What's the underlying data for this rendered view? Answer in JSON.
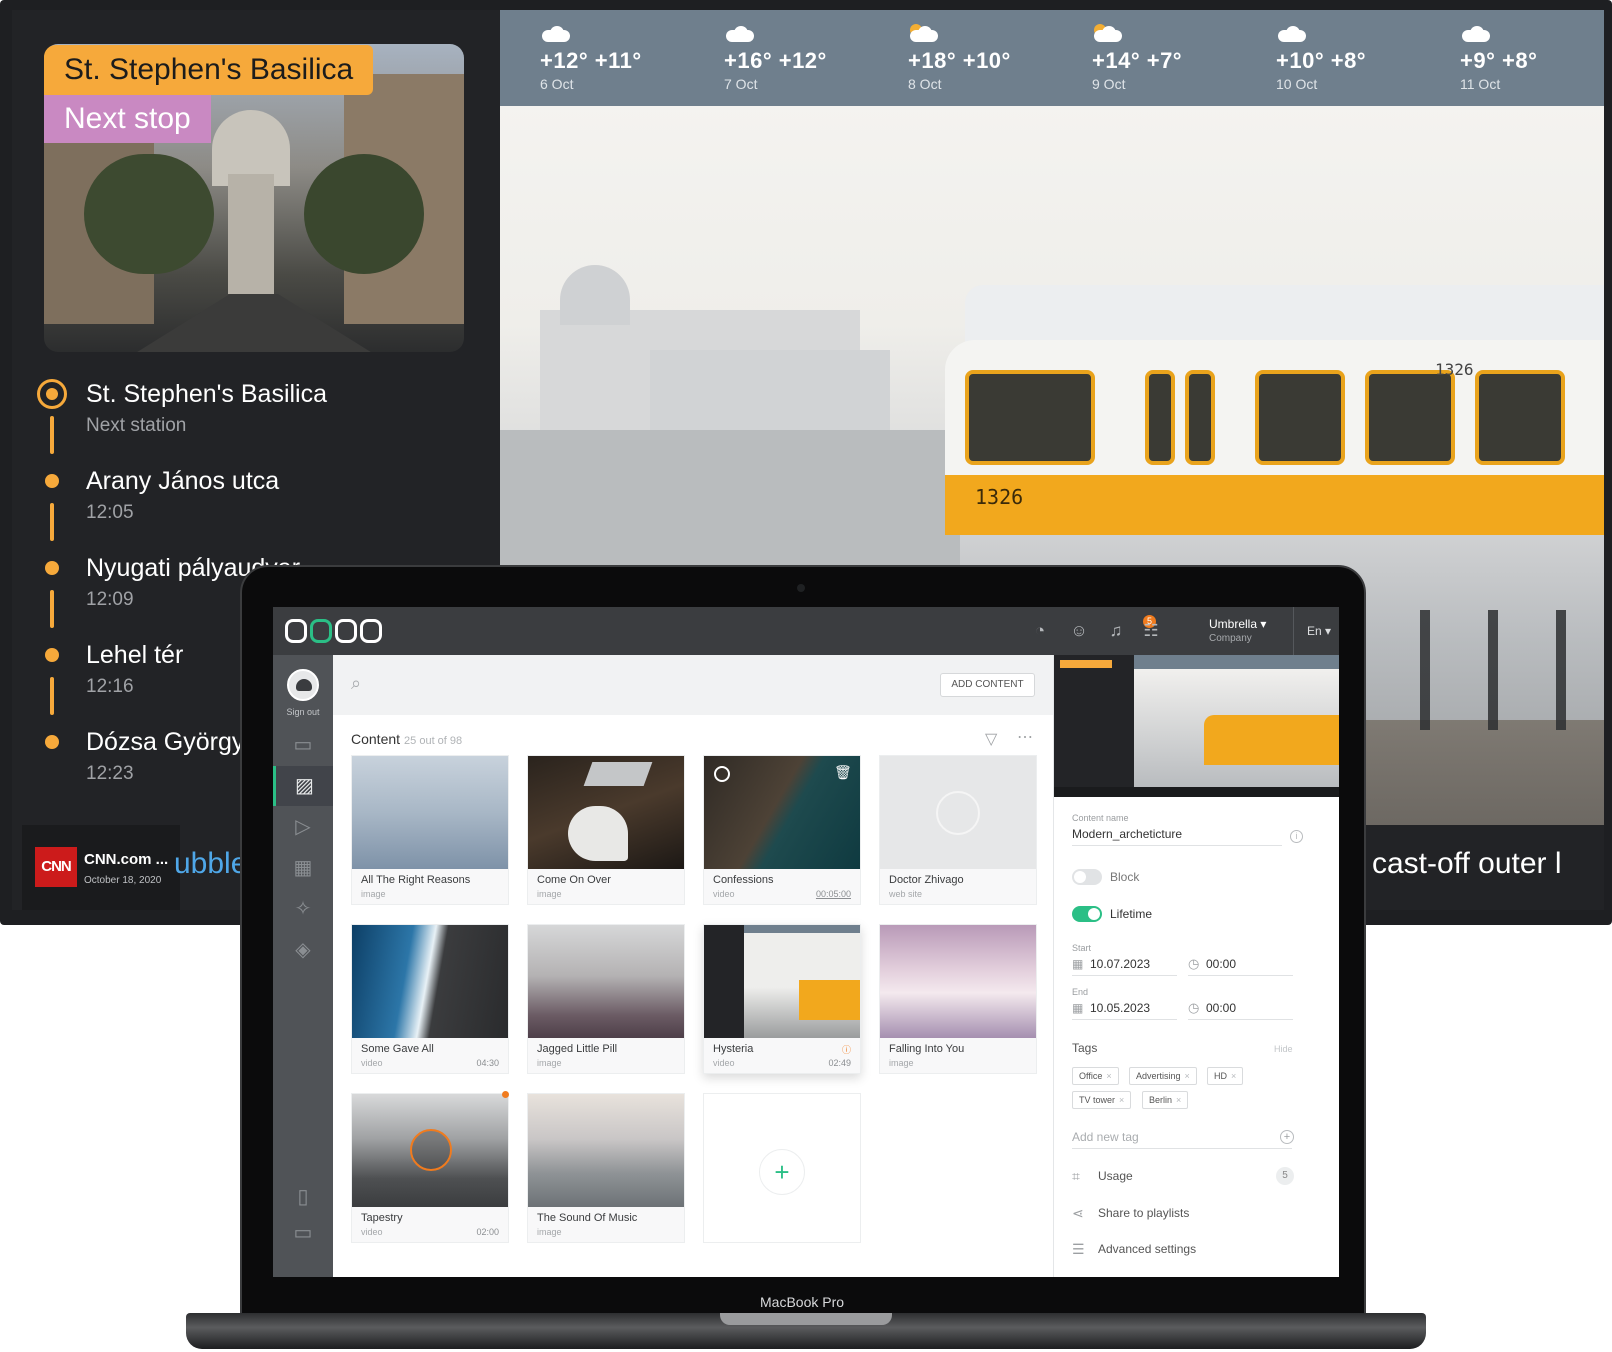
{
  "tv": {
    "stop_title": "St. Stephen's Basilica",
    "stop_subtitle": "Next stop",
    "route": [
      {
        "name": "St. Stephen's Basilica",
        "info": "Next station",
        "current": true
      },
      {
        "name": "Arany János utca",
        "info": "12:05",
        "current": false
      },
      {
        "name": "Nyugati pályaudvar",
        "info": "12:09",
        "current": false
      },
      {
        "name": "Lehel tér",
        "info": "12:16",
        "current": false
      },
      {
        "name": "Dózsa György",
        "info": "12:23",
        "current": false
      }
    ],
    "weather": [
      {
        "temp": "+12° +11°",
        "date": "6 Oct",
        "icon": "cloud-icon"
      },
      {
        "temp": "+16° +12°",
        "date": "7 Oct",
        "icon": "cloud-icon"
      },
      {
        "temp": "+18° +10°",
        "date": "8 Oct",
        "icon": "sun-cloud-icon"
      },
      {
        "temp": "+14° +7°",
        "date": "9 Oct",
        "icon": "sun-cloud-icon"
      },
      {
        "temp": "+10° +8°",
        "date": "10 Oct",
        "icon": "cloud-icon"
      },
      {
        "temp": "+9° +8°",
        "date": "11 Oct",
        "icon": "cloud-icon"
      }
    ],
    "tram_number": "1326",
    "news": {
      "logo": "CNN",
      "source": "CNN.com ...",
      "date": "October 18, 2020",
      "ticker_left": "ubble",
      "ticker_right": "cast-off outer l"
    }
  },
  "laptop": {
    "brand": "MacBook Pro",
    "topbar": {
      "notifications_count": "5",
      "account_name": "Umbrella ▾",
      "account_role": "Company",
      "language": "En ▾"
    },
    "sidenav": {
      "signout_label": "Sign out"
    },
    "main": {
      "add_content_label": "ADD CONTENT",
      "content_title": "Content",
      "content_count": "25 out of 98",
      "cards": [
        {
          "title": "All The Right Reasons",
          "type": "image",
          "duration": ""
        },
        {
          "title": "Come On Over",
          "type": "image",
          "duration": ""
        },
        {
          "title": "Confessions",
          "type": "video",
          "duration": "00:05:00"
        },
        {
          "title": "Doctor Zhivago",
          "type": "web site",
          "duration": ""
        },
        {
          "title": "Some Gave All",
          "type": "video",
          "duration": "04:30"
        },
        {
          "title": "Jagged Little Pill",
          "type": "image",
          "duration": ""
        },
        {
          "title": "Hysteria",
          "type": "video",
          "duration": "02:49"
        },
        {
          "title": "Falling Into You",
          "type": "image",
          "duration": ""
        },
        {
          "title": "Tapestry",
          "type": "video",
          "duration": "02:00"
        },
        {
          "title": "The Sound Of Music",
          "type": "image",
          "duration": ""
        }
      ]
    },
    "details": {
      "content_name_label": "Content name",
      "content_name": "Modern_archeticture",
      "block_label": "Block",
      "block_on": false,
      "lifetime_label": "Lifetime",
      "lifetime_on": true,
      "start_label": "Start",
      "start_date": "10.07.2023",
      "start_time": "00:00",
      "end_label": "End",
      "end_date": "10.05.2023",
      "end_time": "00:00",
      "tags_label": "Tags",
      "tags_hide": "Hide",
      "tags": [
        "Office",
        "Advertising",
        "HD",
        "TV tower",
        "Berlin"
      ],
      "add_tag_placeholder": "Add new tag",
      "usage_label": "Usage",
      "usage_count": "5",
      "share_label": "Share to playlists",
      "advanced_label": "Advanced settings"
    }
  },
  "colors": {
    "accent_orange": "#f6a93b",
    "accent_pink": "#c989c2",
    "accent_green": "#2bbf86",
    "cnn_red": "#cc1b1b",
    "weather_bar": "#6f7f8d"
  }
}
